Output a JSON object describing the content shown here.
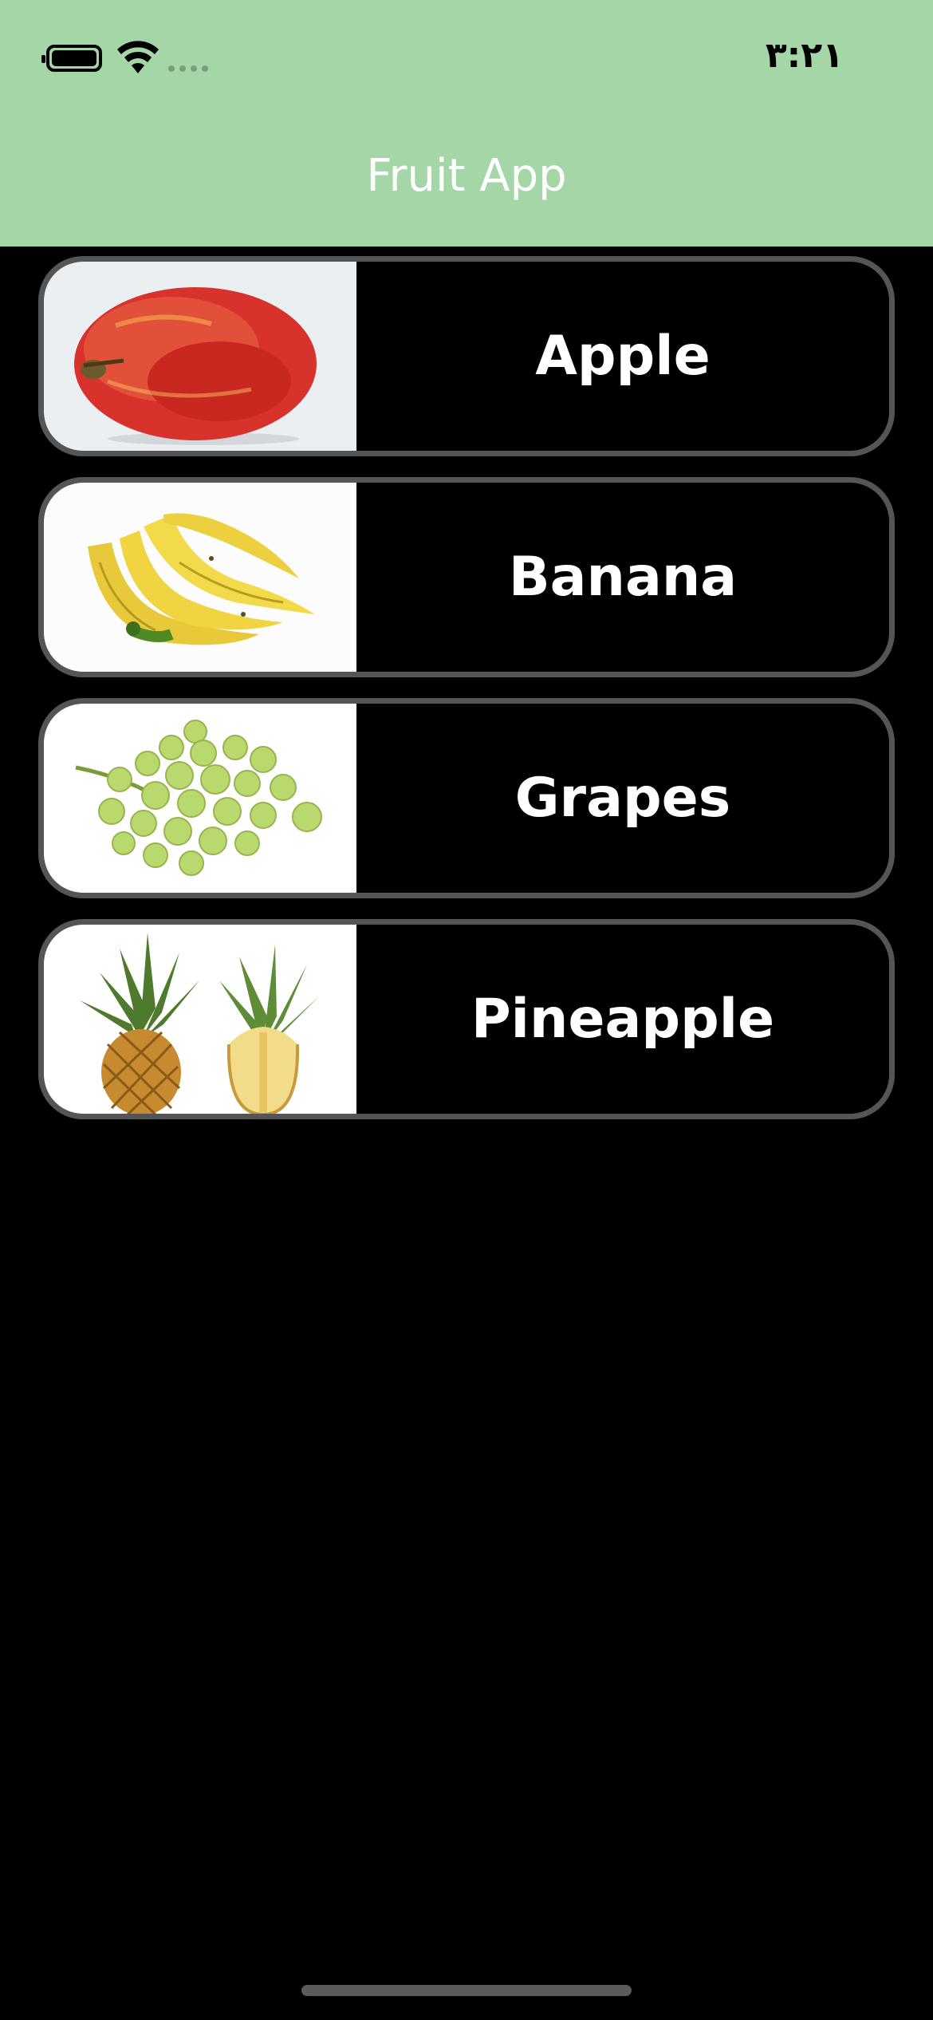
{
  "status_bar": {
    "time": "٣:٢١",
    "icons": [
      "battery-icon",
      "wifi-icon",
      "signal-icon"
    ]
  },
  "header": {
    "title": "Fruit App",
    "background_color": "#a5d6a7"
  },
  "fruits": [
    {
      "label": "Apple",
      "image": "apple-image"
    },
    {
      "label": "Banana",
      "image": "banana-image"
    },
    {
      "label": "Grapes",
      "image": "grapes-image"
    },
    {
      "label": "Pineapple",
      "image": "pineapple-image"
    }
  ],
  "colors": {
    "background": "#000000",
    "card_border": "#555555",
    "text": "#ffffff"
  }
}
